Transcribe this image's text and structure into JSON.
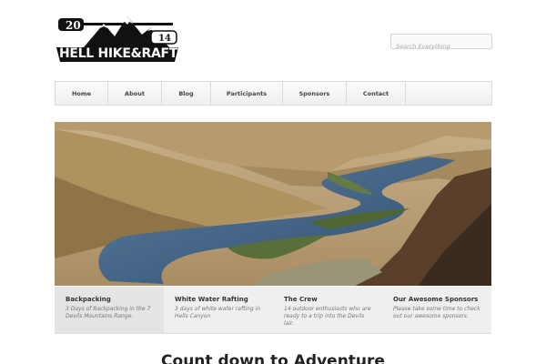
{
  "logo": {
    "year_left": "20",
    "year_right": "14",
    "text": "HELL HIKE&RAFT",
    "icon": "mountains-paddle-logo"
  },
  "search": {
    "placeholder": "Search Everything",
    "value": ""
  },
  "nav": {
    "items": [
      {
        "label": "Home"
      },
      {
        "label": "About"
      },
      {
        "label": "Blog"
      },
      {
        "label": "Participants"
      },
      {
        "label": "Sponsors"
      },
      {
        "label": "Contact"
      }
    ]
  },
  "hero": {
    "image": "river-canyon-photo"
  },
  "features": [
    {
      "title": "Backpacking",
      "desc": "3 Days of Backpacking in the 7 Devils Mountains Range."
    },
    {
      "title": "White Water Rafting",
      "desc": "3 days of white water rafting in Hells Canyon"
    },
    {
      "title": "The Crew",
      "desc": "14 outdoor enthusiasts who are ready to a trip into the Devils lair."
    },
    {
      "title": "Our Awesome Sponsors",
      "desc": "Please take some time to check out our awesome sponsors."
    }
  ],
  "countdown": {
    "title": "Count down to Adventure"
  }
}
